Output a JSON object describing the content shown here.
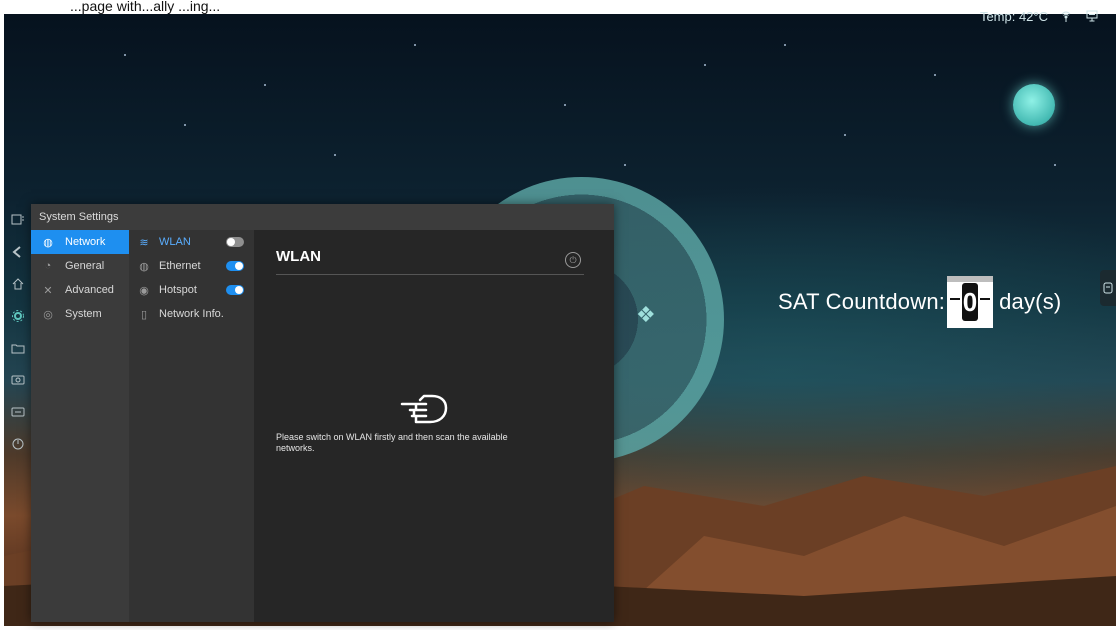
{
  "caption": "...page with...ally ...ing...",
  "status": {
    "temp": "Temp: 42°C"
  },
  "countdown": {
    "label": "SAT Countdown:",
    "value": "0",
    "unit": "day(s)"
  },
  "window": {
    "title": "System Settings",
    "nav": [
      {
        "label": "Network",
        "icon": "globe-icon",
        "active": true
      },
      {
        "label": "General",
        "icon": "palette-icon",
        "active": false
      },
      {
        "label": "Advanced",
        "icon": "tools-icon",
        "active": false
      },
      {
        "label": "System",
        "icon": "system-icon",
        "active": false
      }
    ],
    "subnav": [
      {
        "label": "WLAN",
        "icon": "wifi-icon",
        "toggle": "off"
      },
      {
        "label": "Ethernet",
        "icon": "globe-icon",
        "toggle": "on"
      },
      {
        "label": "Hotspot",
        "icon": "hotspot-icon",
        "toggle": "on"
      },
      {
        "label": "Network Info.",
        "icon": "info-icon",
        "toggle": "none"
      }
    ],
    "pane": {
      "title": "WLAN",
      "message": "Please switch on WLAN firstly and then scan the available networks."
    }
  },
  "colors": {
    "accent": "#1e8ff0",
    "panel": "#262626"
  }
}
